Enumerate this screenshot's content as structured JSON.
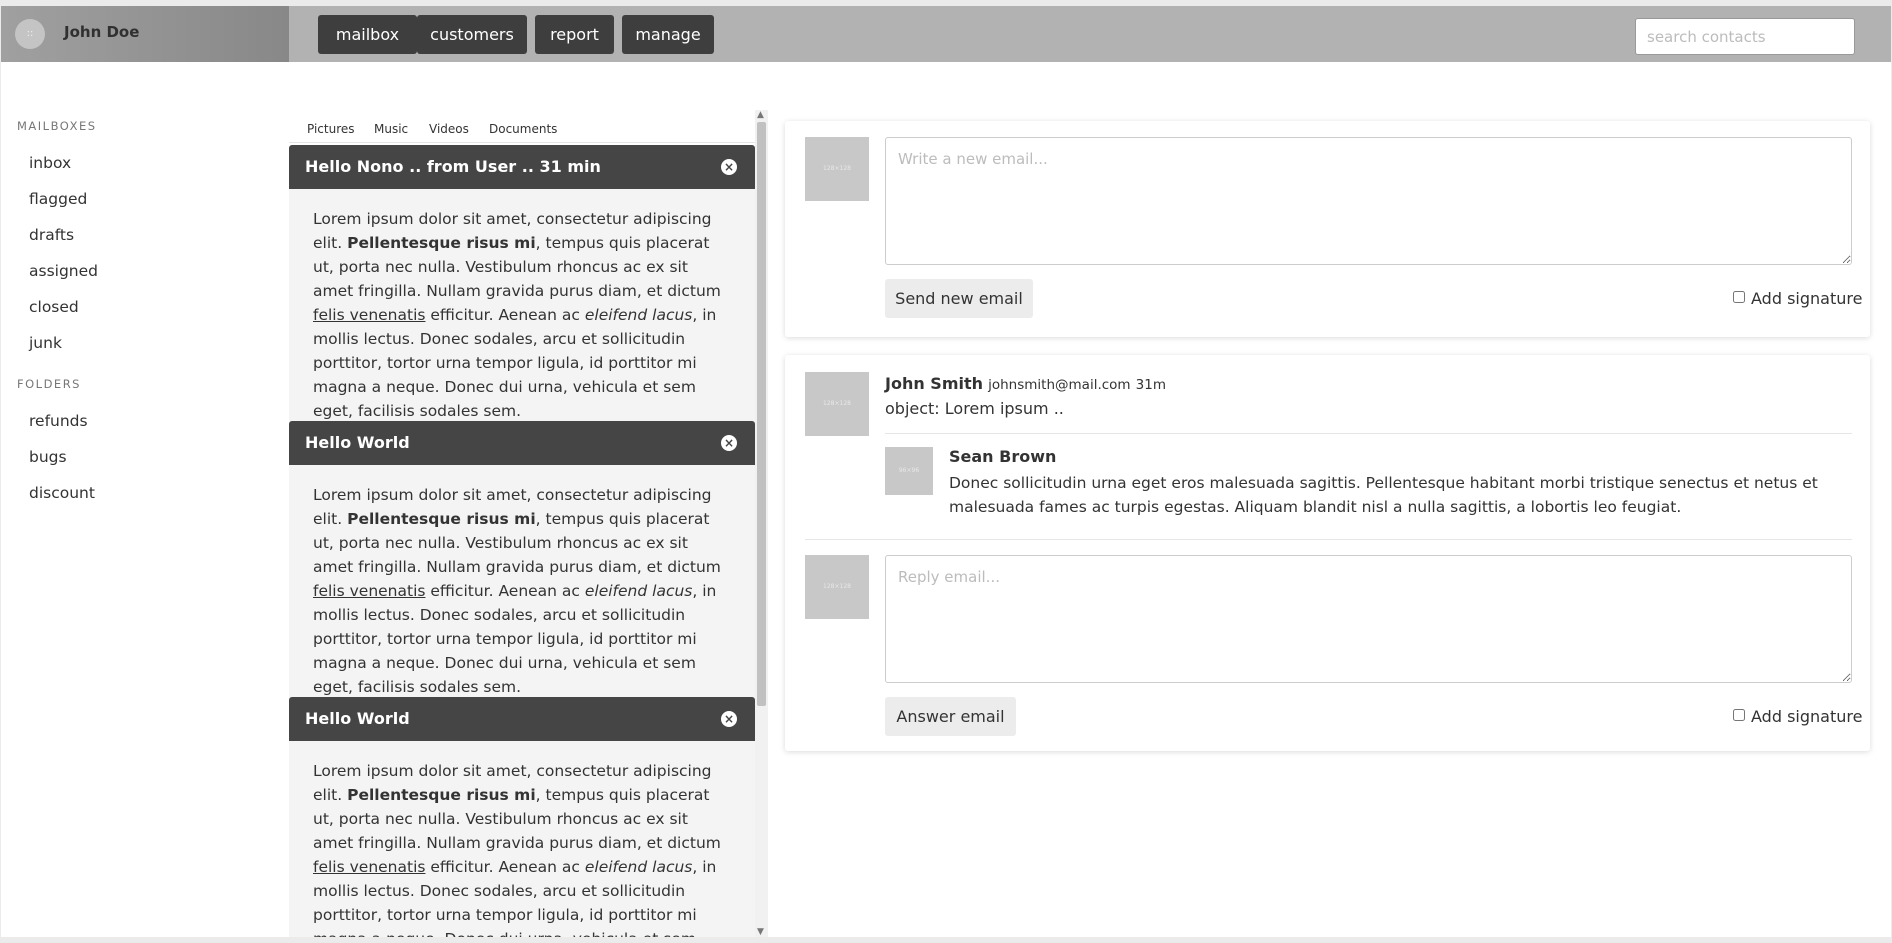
{
  "user": {
    "name": "John Doe",
    "avatar_label": "::"
  },
  "nav": [
    "mailbox",
    "customers",
    "report",
    "manage"
  ],
  "search": {
    "placeholder": "search contacts"
  },
  "sidebar": {
    "mailboxes_heading": "MAILBOXES",
    "mailboxes": [
      "inbox",
      "flagged",
      "drafts",
      "assigned",
      "closed",
      "junk"
    ],
    "folders_heading": "FOLDERS",
    "folders": [
      "refunds",
      "bugs",
      "discount"
    ]
  },
  "tabs": [
    "Pictures",
    "Music",
    "Videos",
    "Documents"
  ],
  "messages": [
    {
      "title": "Hello Nono .. from User .. 31 min"
    },
    {
      "title": "Hello World"
    },
    {
      "title": "Hello World"
    }
  ],
  "body": {
    "p1": "Lorem ipsum dolor sit amet, consectetur adipiscing elit.",
    "bold": "Pellentesque risus mi",
    "p2": ", tempus quis placerat ut, porta nec nulla. Vestibulum rhoncus ac ex sit amet fringilla. Nullam gravida purus diam, et dictum ",
    "link": "felis venenatis",
    "p3": " efficitur. Aenean ac ",
    "italic": "eleifend lacus",
    "p4": ", in mollis lectus. Donec sodales, arcu et sollicitudin porttitor, tortor urna tempor ligula, id porttitor mi magna a neque. Donec dui urna, vehicula et sem eget, facilisis sodales sem."
  },
  "close_glyph": "×",
  "compose": {
    "avatar_label": "128×128",
    "placeholder": "Write a new email...",
    "send_label": "Send new email",
    "signature_label": "Add signature"
  },
  "thread": {
    "avatar_label": "128×128",
    "sender_name": "John Smith",
    "sender_email": "johnsmith@mail.com",
    "time": "31m",
    "object": "object: Lorem ipsum ..",
    "reply": {
      "avatar_label": "96×96",
      "name": "Sean Brown",
      "text": "Donec sollicitudin urna eget eros malesuada sagittis. Pellentesque habitant morbi tristique senectus et netus et malesuada fames ac turpis egestas. Aliquam blandit nisl a nulla sagittis, a lobortis leo feugiat."
    },
    "reply_avatar_label": "128×128",
    "reply_placeholder": "Reply email...",
    "answer_label": "Answer email",
    "signature_label": "Add signature"
  },
  "colors": {
    "topbar": "#b2b2b2",
    "nav_button": "#3e3e3e",
    "message_header": "#454545",
    "message_body": "#f4f4f4"
  }
}
